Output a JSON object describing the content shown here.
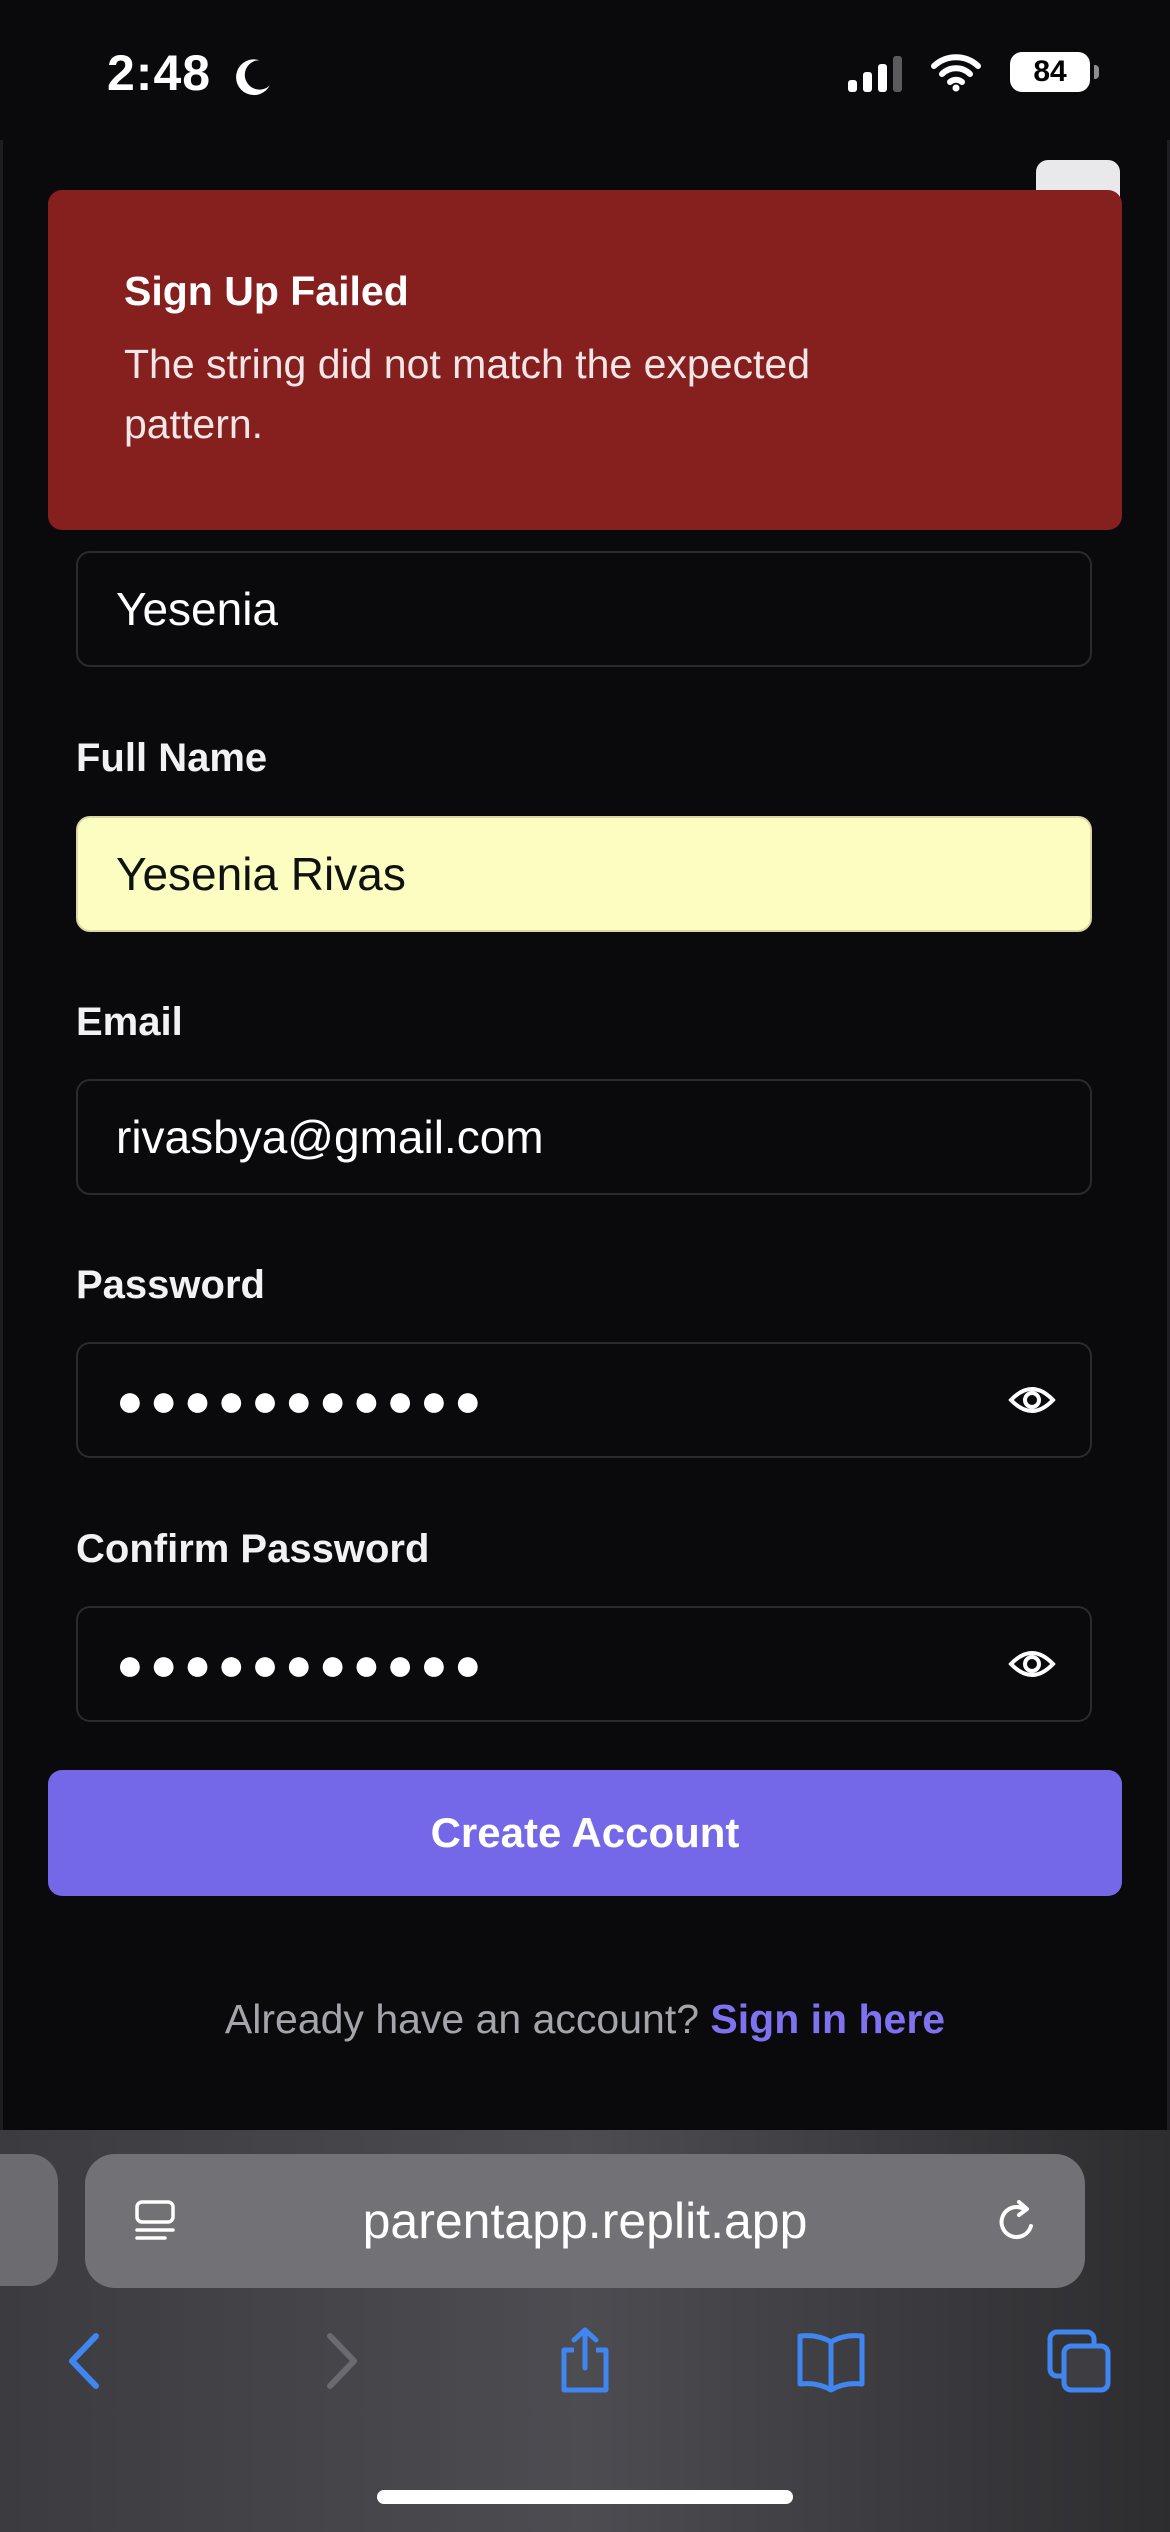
{
  "status_bar": {
    "time": "2:48",
    "battery": "84"
  },
  "toast": {
    "title": "Sign Up Failed",
    "message": "The string did not match the expected pattern."
  },
  "form": {
    "username_value": "Yesenia",
    "full_name_label": "Full Name",
    "full_name_value": "Yesenia Rivas",
    "email_label": "Email",
    "email_value": "rivasbya@gmail.com",
    "password_label": "Password",
    "password_value": "●●●●●●●●●●●",
    "confirm_label": "Confirm Password",
    "confirm_value": "●●●●●●●●●●●",
    "submit_label": "Create Account",
    "signin_prompt": "Already have an account?",
    "signin_link": "Sign in here"
  },
  "browser": {
    "url": "parentapp.replit.app"
  },
  "colors": {
    "toast_bg": "#86201f",
    "accent": "#7468e8",
    "link": "#7f72f0",
    "autofill": "#fbfdc1",
    "safari_blue": "#3f86f1"
  },
  "icons": [
    "moon-icon",
    "signal-icon",
    "wifi-icon",
    "battery-icon",
    "eye-icon",
    "reader-icon",
    "reload-icon",
    "back-icon",
    "forward-icon",
    "share-icon",
    "bookmarks-icon",
    "tabs-icon"
  ]
}
